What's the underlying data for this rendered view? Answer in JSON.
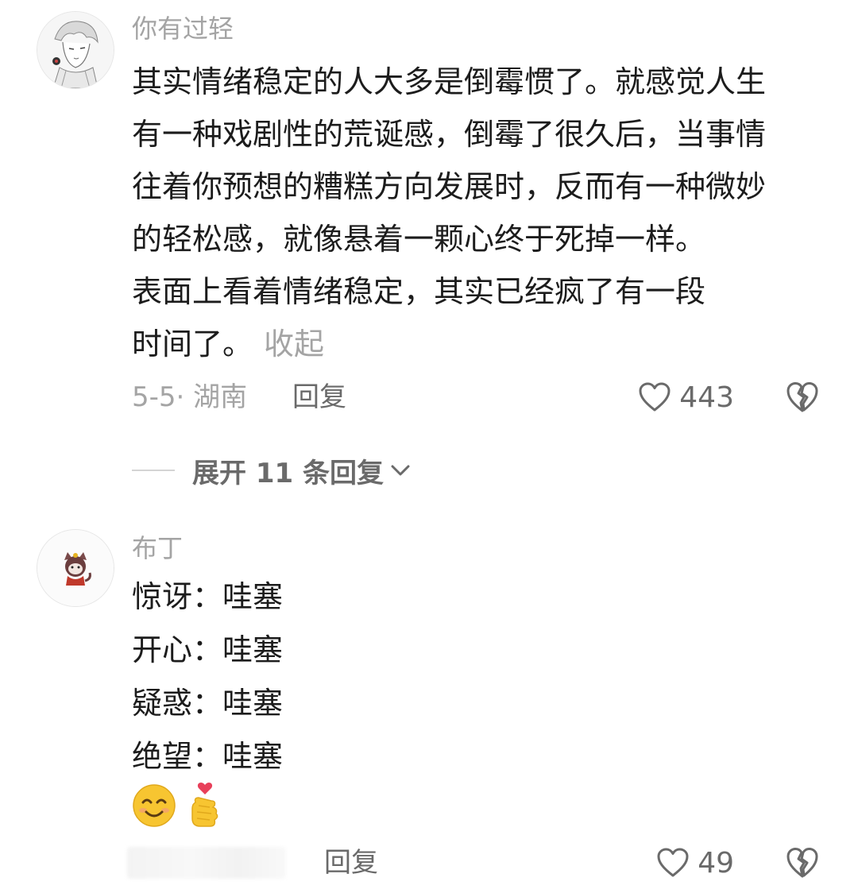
{
  "comments": [
    {
      "username": "你有过轻",
      "body_lines": [
        "其实情绪稳定的人大多是倒霉惯了。就感觉人生",
        "有一种戏剧性的荒诞感，倒霉了很久后，当事情",
        "往着你预想的糟糕方向发展时，反而有一种微妙",
        "的轻松感，就像悬着一颗心终于死掉一样。",
        "表面上看着情绪稳定，其实已经疯了有一段",
        "时间了。"
      ],
      "collapse_label": "收起",
      "date_location": "5-5· 湖南",
      "reply_label": "回复",
      "like_count": "443",
      "expand_replies_label": "展开 11 条回复"
    },
    {
      "username": "布丁",
      "body_lines": [
        "惊讶：哇塞",
        "开心：哇塞",
        "疑惑：哇塞",
        "绝望：哇塞"
      ],
      "emojis": [
        "smiling-face-emoji",
        "finger-heart-emoji"
      ],
      "reply_label": "回复",
      "like_count": "49"
    }
  ],
  "colors": {
    "primary_text": "#1c1c1c",
    "secondary_text": "#a4a4a4",
    "action_text": "#6a6a6a",
    "emoji_yellow": "#f7c531",
    "heart_red": "#e8405a"
  }
}
